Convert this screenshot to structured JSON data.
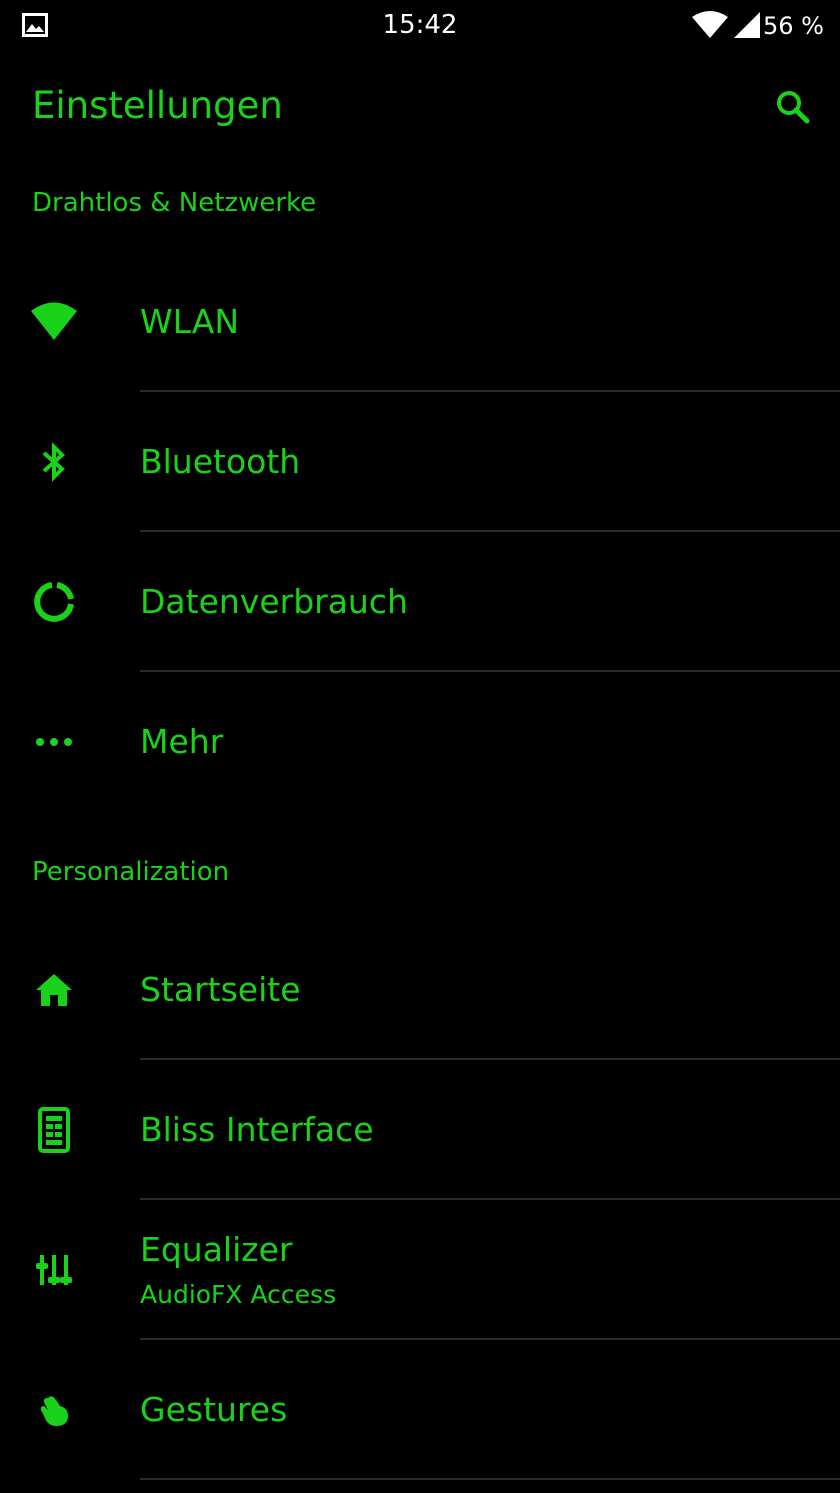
{
  "status_bar": {
    "time": "15:42",
    "battery": "56 %",
    "icons": [
      "image-notification-icon",
      "wifi-icon",
      "cell-signal-icon"
    ]
  },
  "toolbar": {
    "title": "Einstellungen",
    "search_icon": "search-icon"
  },
  "colors": {
    "accent": "#1ad21a",
    "background": "#000000",
    "divider": "#2a2a2a",
    "status_text": "#ffffff"
  },
  "sections": [
    {
      "header": "Drahtlos & Netzwerke",
      "items": [
        {
          "label": "WLAN",
          "icon": "wifi-icon"
        },
        {
          "label": "Bluetooth",
          "icon": "bluetooth-icon"
        },
        {
          "label": "Datenverbrauch",
          "icon": "data-usage-icon"
        },
        {
          "label": "Mehr",
          "icon": "more-dots-icon"
        }
      ]
    },
    {
      "header": "Personalization",
      "items": [
        {
          "label": "Startseite",
          "icon": "home-icon"
        },
        {
          "label": "Bliss Interface",
          "icon": "device-interface-icon"
        },
        {
          "label": "Equalizer",
          "sublabel": "AudioFX Access",
          "icon": "equalizer-icon"
        },
        {
          "label": "Gestures",
          "icon": "gesture-icon"
        }
      ]
    }
  ]
}
